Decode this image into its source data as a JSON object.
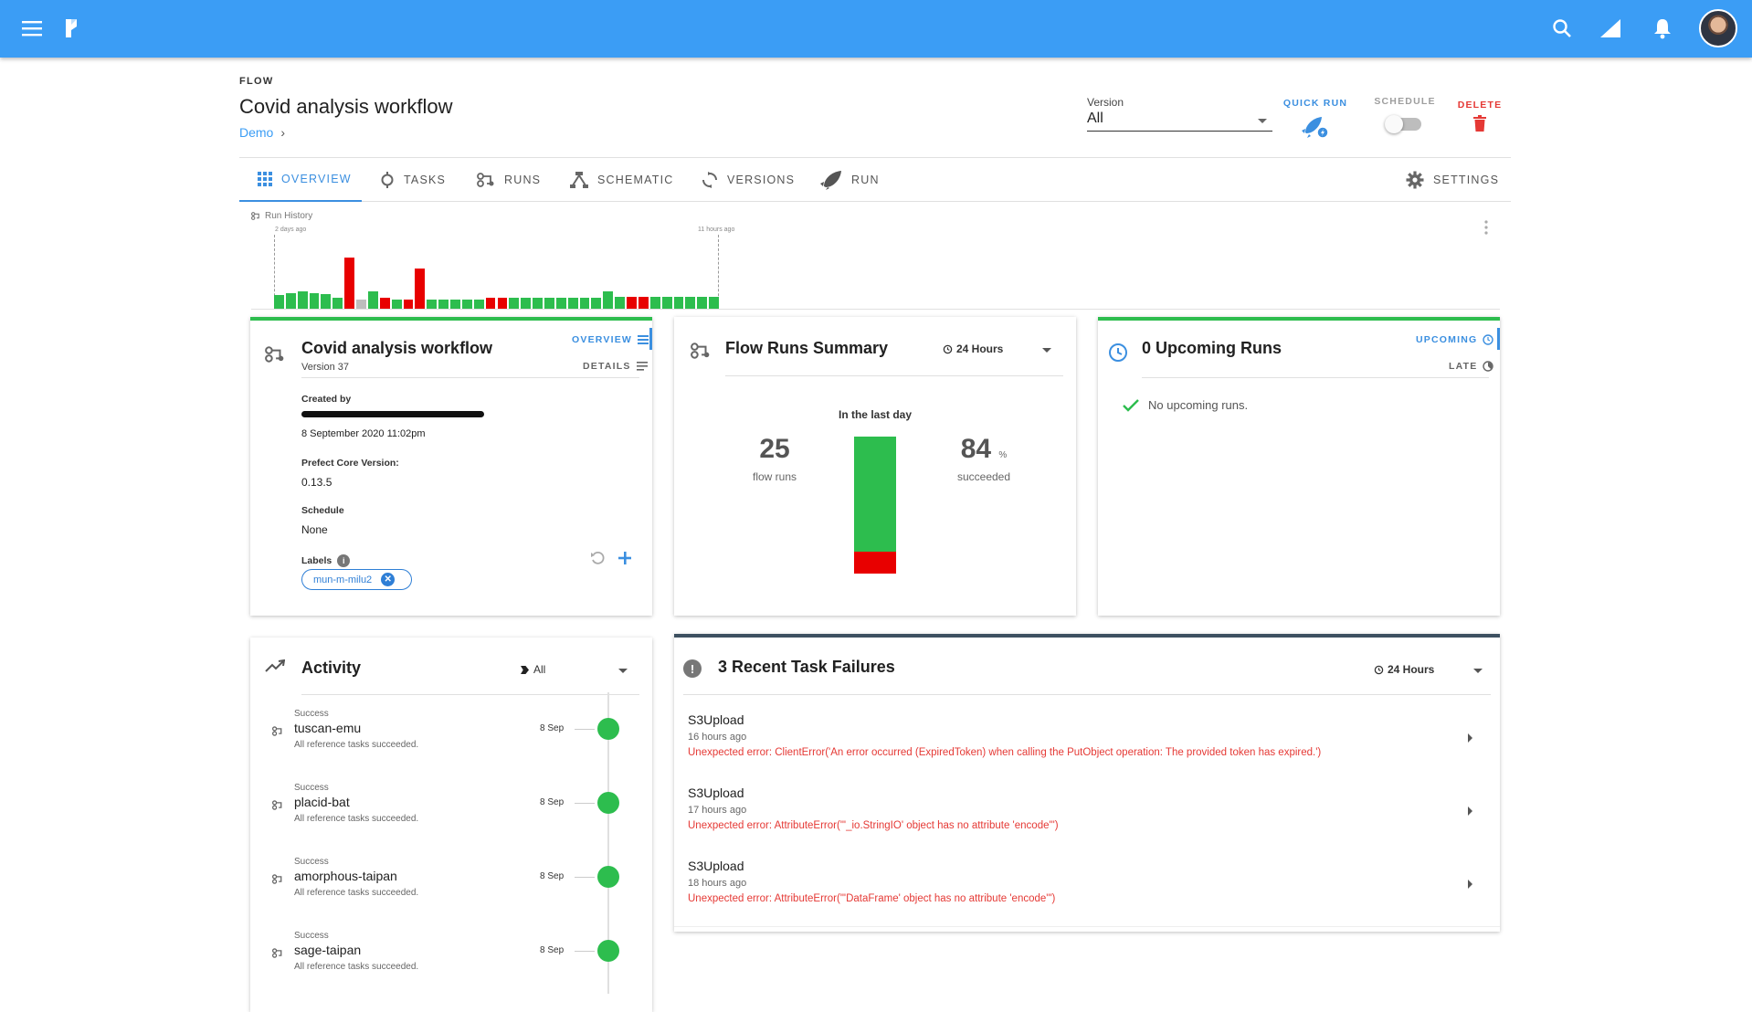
{
  "colors": {
    "primary": "#3b9df5",
    "accent": "#3b8fe0",
    "success": "#2dbd4e",
    "failed": "#e80000",
    "cancelled": "#bdbdbd",
    "danger": "#e53935"
  },
  "topbar": {
    "icons": [
      "menu-icon",
      "prefect-logo-icon",
      "search-icon",
      "signal-icon",
      "bell-icon",
      "avatar"
    ]
  },
  "header": {
    "caption": "FLOW",
    "title": "Covid analysis workflow",
    "breadcrumb": "Demo",
    "version_label": "Version",
    "version_value": "All",
    "quick_run": "QUICK RUN",
    "schedule": "SCHEDULE",
    "schedule_on": false,
    "delete": "DELETE"
  },
  "tabs": [
    {
      "label": "OVERVIEW",
      "icon": "grid-icon",
      "active": true
    },
    {
      "label": "TASKS",
      "icon": "task-icon"
    },
    {
      "label": "RUNS",
      "icon": "runs-icon"
    },
    {
      "label": "SCHEMATIC",
      "icon": "schematic-icon"
    },
    {
      "label": "VERSIONS",
      "icon": "sync-icon"
    },
    {
      "label": "RUN",
      "icon": "rocket-icon"
    },
    {
      "label": "SETTINGS",
      "icon": "gear-icon"
    }
  ],
  "run_history": {
    "label": "Run History",
    "start_label": "2 days ago",
    "end_label": "11 hours ago",
    "chart_data": {
      "type": "bar",
      "bars": [
        {
          "value": 0.18,
          "state": "success"
        },
        {
          "value": 0.2,
          "state": "success"
        },
        {
          "value": 0.23,
          "state": "success"
        },
        {
          "value": 0.2,
          "state": "success"
        },
        {
          "value": 0.19,
          "state": "success"
        },
        {
          "value": 0.14,
          "state": "success"
        },
        {
          "value": 0.67,
          "state": "failed"
        },
        {
          "value": 0.12,
          "state": "cancelled"
        },
        {
          "value": 0.23,
          "state": "success"
        },
        {
          "value": 0.15,
          "state": "failed"
        },
        {
          "value": 0.12,
          "state": "success"
        },
        {
          "value": 0.12,
          "state": "failed"
        },
        {
          "value": 0.53,
          "state": "failed"
        },
        {
          "value": 0.12,
          "state": "success"
        },
        {
          "value": 0.12,
          "state": "success"
        },
        {
          "value": 0.12,
          "state": "success"
        },
        {
          "value": 0.12,
          "state": "success"
        },
        {
          "value": 0.12,
          "state": "success"
        },
        {
          "value": 0.14,
          "state": "failed"
        },
        {
          "value": 0.14,
          "state": "failed"
        },
        {
          "value": 0.14,
          "state": "success"
        },
        {
          "value": 0.14,
          "state": "success"
        },
        {
          "value": 0.14,
          "state": "success"
        },
        {
          "value": 0.14,
          "state": "success"
        },
        {
          "value": 0.14,
          "state": "success"
        },
        {
          "value": 0.14,
          "state": "success"
        },
        {
          "value": 0.14,
          "state": "success"
        },
        {
          "value": 0.14,
          "state": "success"
        },
        {
          "value": 0.23,
          "state": "success"
        },
        {
          "value": 0.16,
          "state": "success"
        },
        {
          "value": 0.16,
          "state": "failed"
        },
        {
          "value": 0.16,
          "state": "failed"
        },
        {
          "value": 0.16,
          "state": "success"
        },
        {
          "value": 0.16,
          "state": "success"
        },
        {
          "value": 0.16,
          "state": "success"
        },
        {
          "value": 0.16,
          "state": "success"
        },
        {
          "value": 0.16,
          "state": "success"
        },
        {
          "value": 0.16,
          "state": "success"
        }
      ]
    }
  },
  "details_card": {
    "title": "Covid analysis workflow",
    "version": "Version 37",
    "overview_link": "OVERVIEW",
    "details_link": "DETAILS",
    "created_by_label": "Created by",
    "created_at": "8 September 2020 11:02pm",
    "core_version_label": "Prefect Core Version:",
    "core_version": "0.13.5",
    "schedule_label": "Schedule",
    "schedule_value": "None",
    "labels_label": "Labels",
    "labels": [
      "mun-m-milu2"
    ]
  },
  "summary_card": {
    "title": "Flow Runs Summary",
    "range": "24 Hours",
    "subtitle": "In the last day",
    "flow_runs": "25",
    "flow_runs_label": "flow runs",
    "succeeded_pct": "84",
    "pct_sign": "%",
    "succeeded_label": "succeeded",
    "chart_data": {
      "type": "bar",
      "categories": [
        "In the last day"
      ],
      "series": [
        {
          "name": "succeeded",
          "values": [
            84
          ]
        },
        {
          "name": "failed",
          "values": [
            16
          ]
        }
      ]
    }
  },
  "upcoming_card": {
    "title": "0 Upcoming Runs",
    "upcoming_link": "UPCOMING",
    "late_link": "LATE",
    "empty_text": "No upcoming runs."
  },
  "activity_card": {
    "title": "Activity",
    "filter": "All",
    "items": [
      {
        "status": "Success",
        "name": "tuscan-emu",
        "message": "All reference tasks succeeded.",
        "date": "8 Sep"
      },
      {
        "status": "Success",
        "name": "placid-bat",
        "message": "All reference tasks succeeded.",
        "date": "8 Sep"
      },
      {
        "status": "Success",
        "name": "amorphous-taipan",
        "message": "All reference tasks succeeded.",
        "date": "8 Sep"
      },
      {
        "status": "Success",
        "name": "sage-taipan",
        "message": "All reference tasks succeeded.",
        "date": "8 Sep"
      }
    ]
  },
  "failures_card": {
    "title": "3 Recent Task Failures",
    "range": "24 Hours",
    "items": [
      {
        "name": "S3Upload",
        "time": "16 hours ago",
        "error": "Unexpected error: ClientError('An error occurred (ExpiredToken) when calling the PutObject operation: The provided token has expired.')"
      },
      {
        "name": "S3Upload",
        "time": "17 hours ago",
        "error": "Unexpected error: AttributeError(\"'_io.StringIO' object has no attribute 'encode'\")"
      },
      {
        "name": "S3Upload",
        "time": "18 hours ago",
        "error": "Unexpected error: AttributeError(\"'DataFrame' object has no attribute 'encode'\")"
      }
    ]
  }
}
